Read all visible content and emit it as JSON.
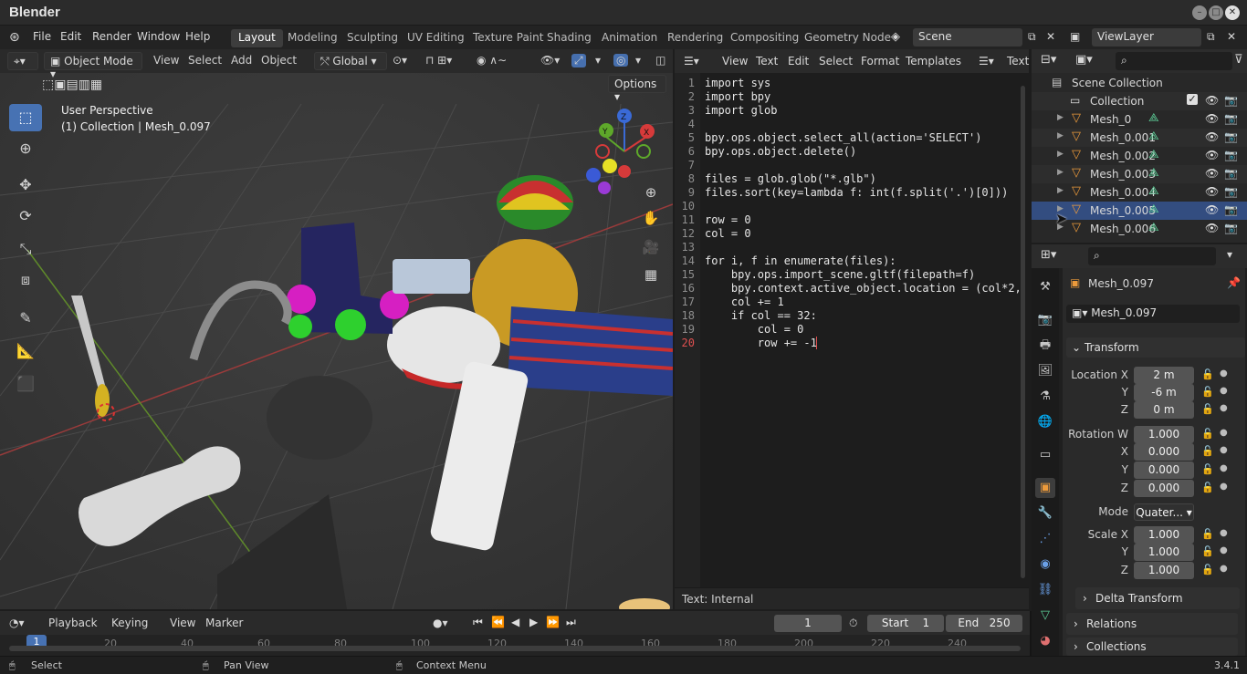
{
  "window": {
    "title": "Blender",
    "controls": [
      "–",
      "□",
      "✕"
    ]
  },
  "menu": [
    "File",
    "Edit",
    "Render",
    "Window",
    "Help"
  ],
  "workspaces": [
    "Layout",
    "Modeling",
    "Sculpting",
    "UV Editing",
    "Texture Paint",
    "Shading",
    "Animation",
    "Rendering",
    "Compositing",
    "Geometry Node"
  ],
  "active_workspace": "Layout",
  "scene": "Scene",
  "view_layer": "ViewLayer",
  "viewport": {
    "mode": "Object Mode",
    "menus": [
      "View",
      "Select",
      "Add",
      "Object"
    ],
    "transform_orientation": "Global",
    "options_label": "Options",
    "overlay_title": "User Perspective",
    "overlay_subtitle": "(1) Collection | Mesh_0.097",
    "axes": {
      "x": "X",
      "y": "Y",
      "z": "Z"
    }
  },
  "text_editor": {
    "menus": [
      "View",
      "Text",
      "Edit",
      "Select",
      "Format",
      "Templates"
    ],
    "text_label": "Text",
    "footer": "Text: Internal",
    "lines": [
      "import sys",
      "import bpy",
      "import glob",
      "",
      "bpy.ops.object.select_all(action='SELECT')",
      "bpy.ops.object.delete()",
      "",
      "files = glob.glob(\"*.glb\")",
      "files.sort(key=lambda f: int(f.split('.')[0]))",
      "",
      "row = 0",
      "col = 0",
      "",
      "for i, f in enumerate(files):",
      "    bpy.ops.import_scene.gltf(filepath=f)",
      "    bpy.context.active_object.location = (col*2,",
      "    col += 1",
      "    if col == 32:",
      "        col = 0",
      "        row += -1"
    ],
    "current_line": 20
  },
  "outliner": {
    "root": "Scene Collection",
    "collection": "Collection",
    "objects": [
      "Mesh_0",
      "Mesh_0.001",
      "Mesh_0.002",
      "Mesh_0.003",
      "Mesh_0.004",
      "Mesh_0.005",
      "Mesh_0.006"
    ],
    "hovered_index": 5
  },
  "properties": {
    "object_name": "Mesh_0.097",
    "data_name": "Mesh_0.097",
    "transform_label": "Transform",
    "location_label": "Location X",
    "location": [
      "2 m",
      "-6 m",
      "0 m"
    ],
    "rotation_label": "Rotation W",
    "rotation": [
      "1.000",
      "0.000",
      "0.000",
      "0.000"
    ],
    "mode_label": "Mode",
    "mode_value": "Quater...",
    "scale_label": "Scale X",
    "scale": [
      "1.000",
      "1.000",
      "1.000"
    ],
    "axis_labels": [
      "Y",
      "Z",
      "X",
      "Y",
      "Z"
    ],
    "delta_transform": "Delta Transform",
    "relations": "Relations",
    "collections": "Collections"
  },
  "timeline": {
    "menus": [
      "Playback",
      "Keying",
      "View",
      "Marker"
    ],
    "current_frame": "1",
    "start_label": "Start",
    "start": "1",
    "end_label": "End",
    "end": "250",
    "ticks": [
      "1",
      "20",
      "40",
      "60",
      "80",
      "100",
      "120",
      "140",
      "160",
      "180",
      "200",
      "220",
      "240"
    ]
  },
  "status": {
    "left": "Select",
    "middle": "Pan View",
    "right": "Context Menu",
    "version": "3.4.1"
  }
}
